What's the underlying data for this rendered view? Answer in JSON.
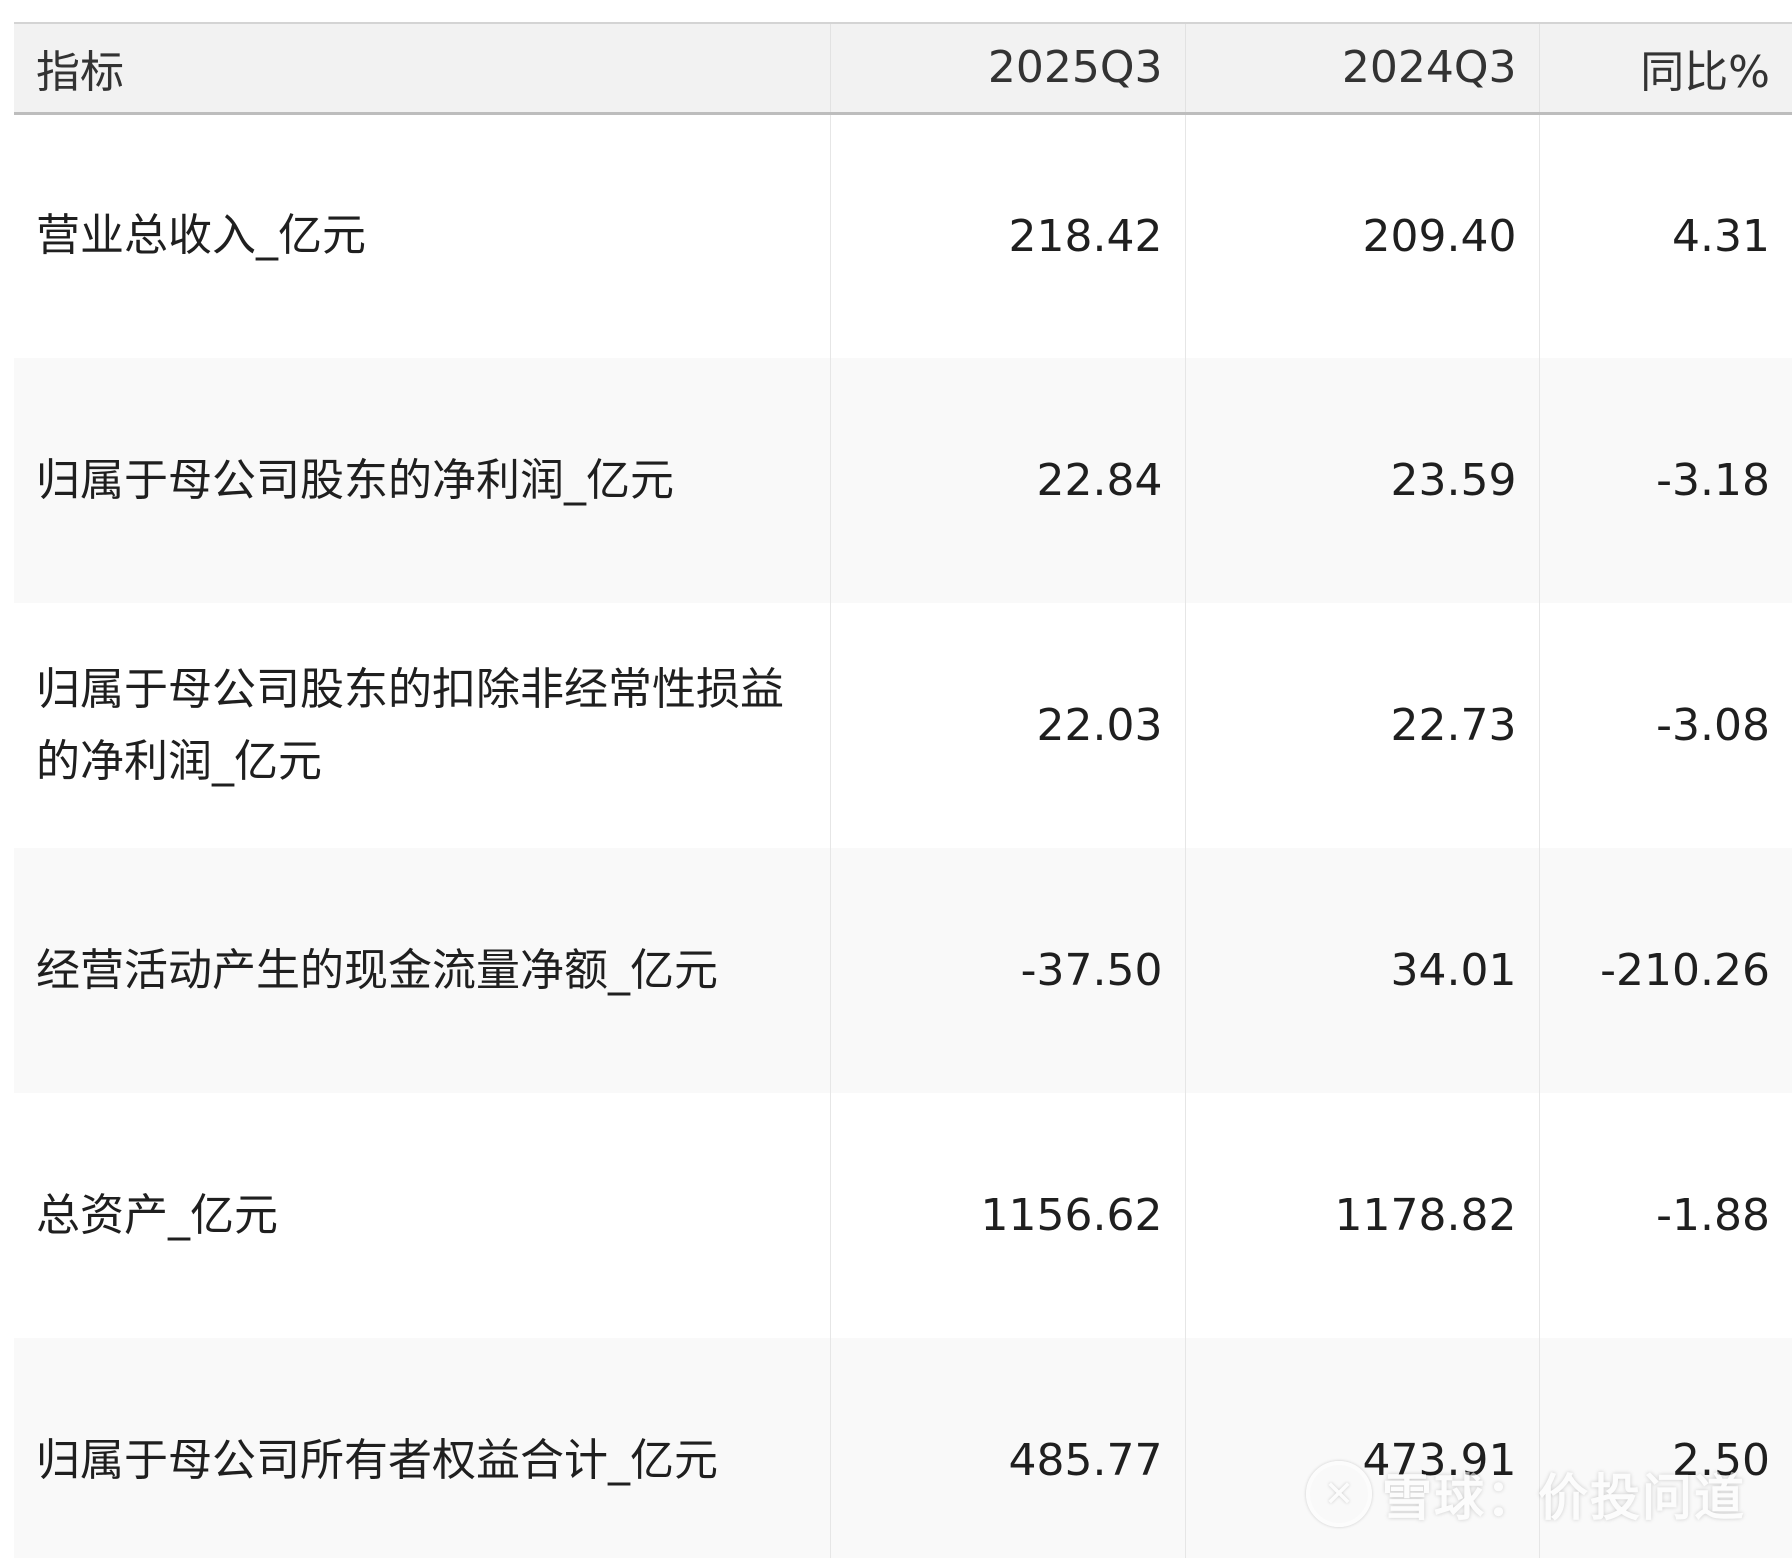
{
  "table": {
    "headers": {
      "metric": "指标",
      "current": "2025Q3",
      "previous": "2024Q3",
      "yoy": "同比%"
    },
    "rows": [
      {
        "metric": "营业总收入_亿元",
        "current": "218.42",
        "previous": "209.40",
        "yoy": "4.31"
      },
      {
        "metric": "归属于母公司股东的净利润_亿元",
        "current": "22.84",
        "previous": "23.59",
        "yoy": "-3.18"
      },
      {
        "metric": "归属于母公司股东的扣除非经常性损益的净利润_亿元",
        "current": "22.03",
        "previous": "22.73",
        "yoy": "-3.08"
      },
      {
        "metric": "经营活动产生的现金流量净额_亿元",
        "current": "-37.50",
        "previous": "34.01",
        "yoy": "-210.26"
      },
      {
        "metric": "总资产_亿元",
        "current": "1156.62",
        "previous": "1178.82",
        "yoy": "-1.88"
      },
      {
        "metric": "归属于母公司所有者权益合计_亿元",
        "current": "485.77",
        "previous": "473.91",
        "yoy": "2.50"
      }
    ]
  },
  "watermark": {
    "icon": "xueqiu-logo-icon",
    "text": "雪球：价投问道"
  }
}
